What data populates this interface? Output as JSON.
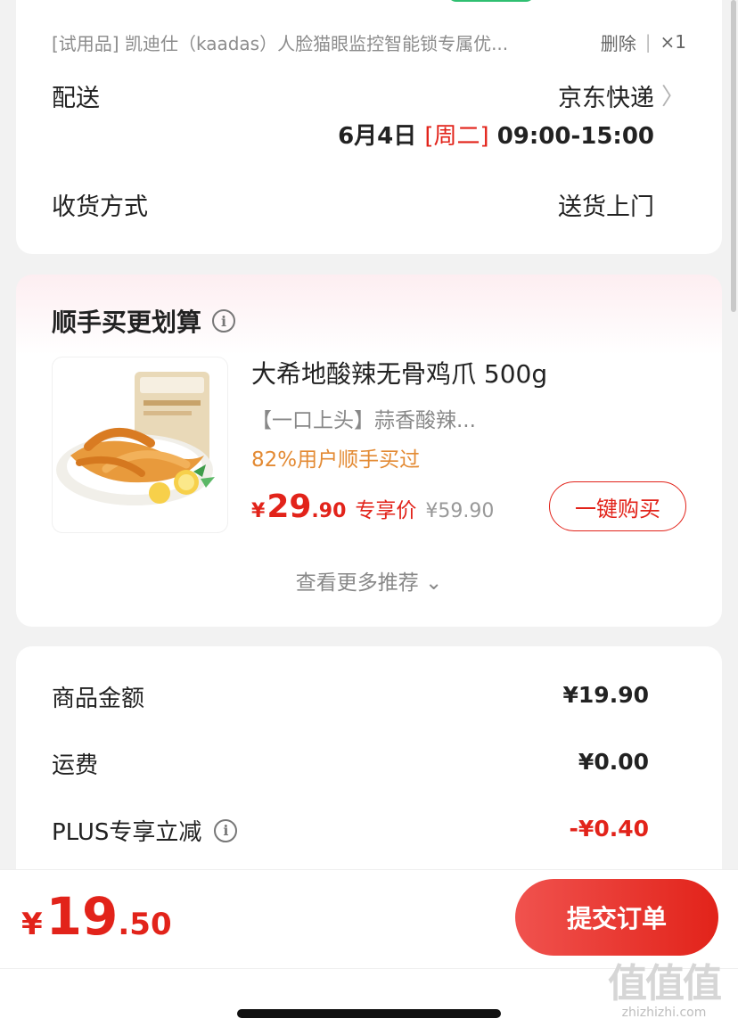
{
  "order": {
    "trial_item": {
      "name": "[试用品] 凯迪仕（kaadas）人脸猫眼监控智能锁专属优...",
      "delete_label": "删除",
      "separator": "|",
      "quantity": "×1"
    },
    "delivery": {
      "label": "配送",
      "carrier": "京东快递",
      "chevron": "〉",
      "date": "6月4日",
      "weekday": "[周二]",
      "time_window": "09:00-15:00"
    },
    "receive": {
      "label": "收货方式",
      "value": "送货上门"
    }
  },
  "recommend": {
    "title": "顺手买更划算",
    "info_icon": "i",
    "product": {
      "name": "大希地酸辣无骨鸡爪 500g",
      "subtitle": "【一口上头】蒜香酸辣...",
      "social_proof": "82%用户顺手买过",
      "price_symbol": "¥",
      "price_int": "29",
      "price_dec": ".90",
      "price_tag": "专享价",
      "original_price": "¥59.90",
      "buy_label": "一键购买"
    },
    "more_label": "查看更多推荐 ⌄"
  },
  "totals": {
    "rows": [
      {
        "label": "商品金额",
        "value": "¥19.90"
      },
      {
        "label": "运费",
        "value": "¥0.00"
      },
      {
        "label": "PLUS专享立减",
        "value": "-¥0.40"
      }
    ],
    "info_icon": "i"
  },
  "footer": {
    "price_symbol": "¥",
    "price_int": "19",
    "price_dec": ".50",
    "submit_label": "提交订单"
  },
  "watermark": {
    "glyphs": "值值值",
    "url": "zhizhizhi.com"
  },
  "colors": {
    "accent": "#e2231a",
    "social": "#e38a33",
    "green_tab": "#2fbf71"
  }
}
